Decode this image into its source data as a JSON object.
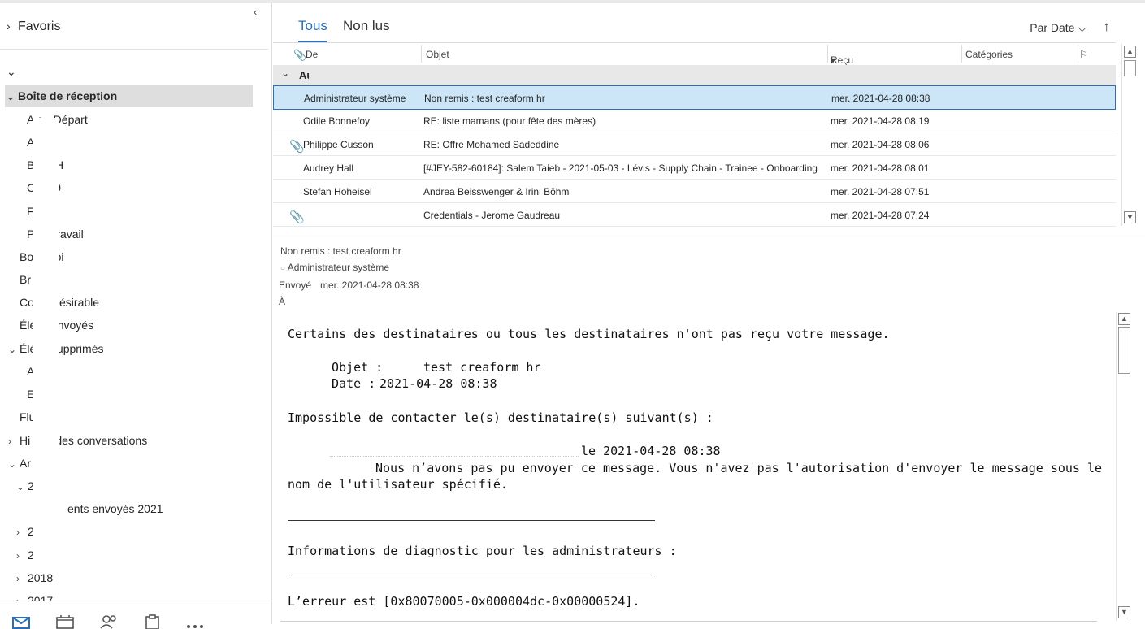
{
  "left": {
    "collapse_icon": "‹",
    "favorites": "Favoris",
    "folders": [
      {
        "label": "Boîte de réception",
        "indent": 0,
        "chev": "down",
        "selected": true
      },
      {
        "label": "A        e - Départ",
        "indent": 1
      },
      {
        "label": "A     n",
        "indent": 1
      },
      {
        "label": "B       n RH",
        "indent": 1
      },
      {
        "label": "C      9-19",
        "indent": 1
      },
      {
        "label": "F        tion",
        "indent": 1
      },
      {
        "label": "P      de travail",
        "indent": 1
      },
      {
        "label": "Bo       envoi",
        "indent": 0
      },
      {
        "label": "Br         ons",
        "indent": 0
      },
      {
        "label": "Co         r indésirable",
        "indent": 0
      },
      {
        "label": "Élé         ts envoyés",
        "indent": 0
      },
      {
        "label": "Élé         ts supprimés",
        "indent": 0,
        "chev": "down"
      },
      {
        "label": "A      il",
        "indent": 1
      },
      {
        "label": "E",
        "indent": 1
      },
      {
        "label": "Flu       S",
        "indent": 0
      },
      {
        "label": "Hi          que des conversations",
        "indent": 0,
        "chev": "right"
      },
      {
        "label": "Ar",
        "indent": 0,
        "chev": "down"
      },
      {
        "label": "2",
        "indent": 1,
        "chev": "down"
      },
      {
        "label": "ents envoyés 2021",
        "indent": 2
      },
      {
        "label": "2",
        "indent": 1,
        "chev": "right"
      },
      {
        "label": "2",
        "indent": 1,
        "chev": "right"
      },
      {
        "label": "2018",
        "indent": 1,
        "chev": "right"
      },
      {
        "label": "2017",
        "indent": 1,
        "chev": "right"
      }
    ],
    "nav_icons": [
      "mail-icon",
      "calendar-icon",
      "people-icon",
      "tasks-icon",
      "more-icon"
    ]
  },
  "list": {
    "tabs": [
      "Tous",
      "Non lus"
    ],
    "sort_label": "Par Date",
    "sort_chevron": "⌵",
    "sort_dir_icon": "↑",
    "columns": {
      "from": "De",
      "subject": "Objet",
      "received": "Reçu",
      "categories": "Catégories"
    },
    "group_label": "Aujourd'hui",
    "rows": [
      {
        "from": "Administrateur système",
        "subject": "Non remis : test creaform hr",
        "received": "mer. 2021-04-28 08:38",
        "attach": false,
        "selected": true
      },
      {
        "from": "Odile Bonnefoy",
        "subject": "RE: liste mamans (pour fête des mères)",
        "received": "mer. 2021-04-28 08:19",
        "attach": false
      },
      {
        "from": "Philippe Cusson",
        "subject": "RE: Offre Mohamed Sadeddine",
        "received": "mer. 2021-04-28 08:06",
        "attach": true
      },
      {
        "from": "Audrey Hall",
        "subject": "[#JEY-582-60184]: Salem Taieb - 2021-05-03 - Lévis - Supply Chain - Trainee - Onboarding",
        "received": "mer. 2021-04-28 08:01",
        "attach": false
      },
      {
        "from": "Stefan Hoheisel",
        "subject": "Andrea Beisswenger & Irini Böhm",
        "received": "mer. 2021-04-28 07:51",
        "attach": false
      },
      {
        "from": "",
        "subject": "Credentials - Jerome Gaudreau",
        "received": "mer. 2021-04-28 07:24",
        "attach": true
      }
    ]
  },
  "reading": {
    "subject": "Non remis : test creaform hr",
    "sender": "Administrateur système",
    "sent_label": "Envoyé",
    "sent_value": "mer. 2021-04-28 08:38",
    "to_label": "À",
    "body": {
      "line1": "Certains des destinataires ou tous les destinataires n'ont pas reçu votre message.",
      "obj_label": "Objet :",
      "obj_value": "test creaform hr",
      "date_label": "Date :",
      "date_value": "2021-04-28 08:38",
      "line3": "Impossible de contacter le(s) destinataire(s) suivant(s) :",
      "recipient_date": "le 2021-04-28 08:38",
      "line5": "Nous n’avons pas pu envoyer ce message. Vous n'avez pas l'autorisation d'envoyer le message sous le",
      "line6": "nom de l'utilisateur spécifié.",
      "line7": "Informations de diagnostic pour les administrateurs :",
      "line8": "L’erreur est [0x80070005-0x000004dc-0x00000524]."
    }
  }
}
